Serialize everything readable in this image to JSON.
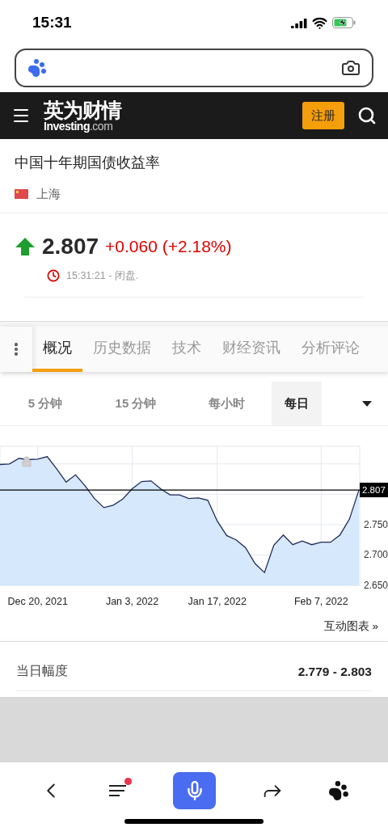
{
  "status_bar": {
    "time": "15:31"
  },
  "header": {
    "logo_cn": "英为财情",
    "logo_en": "Investing",
    "logo_domain": ".com",
    "register_button": "注册"
  },
  "instrument": {
    "title": "中国十年期国债收益率",
    "exchange": "上海",
    "price": "2.807",
    "rising": true,
    "change": "+0.060 (+2.18%)",
    "time_status": "15:31:21 - 闭盘."
  },
  "tabs": [
    {
      "label": "概况",
      "selected": true
    },
    {
      "label": "历史数据",
      "selected": false
    },
    {
      "label": "技术",
      "selected": false
    },
    {
      "label": "财经资讯",
      "selected": false
    },
    {
      "label": "分析评论",
      "selected": false
    }
  ],
  "intervals": [
    {
      "label": "5 分钟",
      "selected": false
    },
    {
      "label": "15 分钟",
      "selected": false
    },
    {
      "label": "每小时",
      "selected": false
    },
    {
      "label": "每日",
      "selected": true
    }
  ],
  "chart": {
    "chart_data": {
      "type": "area",
      "categories": [
        null,
        null,
        null,
        null,
        "Dec 20, 2021",
        null,
        null,
        null,
        null,
        null,
        null,
        null,
        null,
        null,
        "Jan 3, 2022",
        null,
        null,
        null,
        null,
        null,
        null,
        null,
        null,
        "Jan 17, 2022",
        null,
        null,
        null,
        null,
        null,
        null,
        null,
        null,
        null,
        null,
        "Feb 7, 2022",
        null,
        null,
        null,
        null
      ],
      "series": [
        {
          "color": "#1f2a5c",
          "values": [
            2.849,
            2.85,
            2.859,
            2.857,
            2.858,
            2.862,
            2.842,
            2.82,
            2.832,
            2.814,
            2.793,
            2.778,
            2.782,
            2.792,
            2.809,
            2.821,
            2.822,
            2.809,
            2.799,
            2.799,
            2.793,
            2.794,
            2.79,
            2.756,
            2.732,
            2.725,
            2.712,
            2.686,
            2.671,
            2.716,
            2.733,
            2.717,
            2.723,
            2.717,
            2.721,
            2.721,
            2.733,
            2.759,
            2.807
          ]
        }
      ],
      "ylim": [
        2.65,
        2.879
      ],
      "yticks": [
        {
          "value": 2.65,
          "label": "2.650"
        },
        {
          "value": 2.7,
          "label": "2.700"
        },
        {
          "value": 2.75,
          "label": "2.750"
        }
      ],
      "grid": true,
      "ref_lines": [
        {
          "axis": "y",
          "value": 2.807,
          "label": "2.807"
        }
      ]
    },
    "interactive_link": "互动图表 »"
  },
  "stats": [
    {
      "label": "当日幅度",
      "value": "2.779 - 2.803"
    }
  ],
  "bottom_nav": {
    "menu_has_notification": true
  }
}
